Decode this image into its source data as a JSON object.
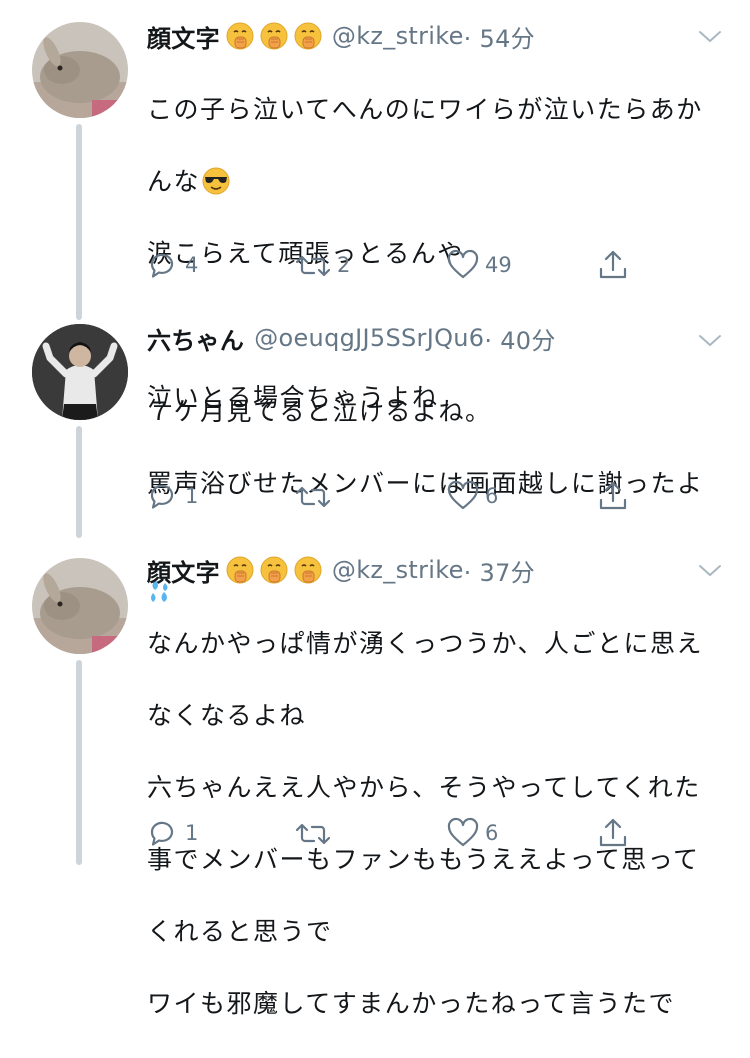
{
  "tweets": [
    {
      "name": "顔文字",
      "handle": "@kz_strike",
      "time": "· 54分",
      "body_lines": [
        "この子ら泣いてへんのにワイらが泣いたらあか",
        "んな",
        "涙こらえて頑張っとるんや",
        "",
        "泣いとる場合ちゃうよね"
      ],
      "reply_count": "4",
      "retweet_count": "2",
      "like_count": "49"
    },
    {
      "name": "六ちゃん",
      "handle": "@oeuqgJJ5SSrJQu6",
      "time": "· 40分",
      "body_lines": [
        "７ケ月見てると泣けるよね。",
        "罵声浴びせたメンバーには画面越しに謝ったよ"
      ],
      "reply_count": "1",
      "retweet_count": "",
      "like_count": "6"
    },
    {
      "name": "顔文字",
      "handle": "@kz_strike",
      "time": "· 37分",
      "body_lines": [
        "なんかやっぱ情が湧くっつうか、人ごとに思え",
        "なくなるよね",
        "六ちゃんええ人やから、そうやってしてくれた",
        "事でメンバーもファンももうええよって思って",
        "くれると思うで",
        "ワイも邪魔してすまんかったねって言うたで"
      ],
      "reply_count": "1",
      "retweet_count": "",
      "like_count": "6"
    }
  ]
}
